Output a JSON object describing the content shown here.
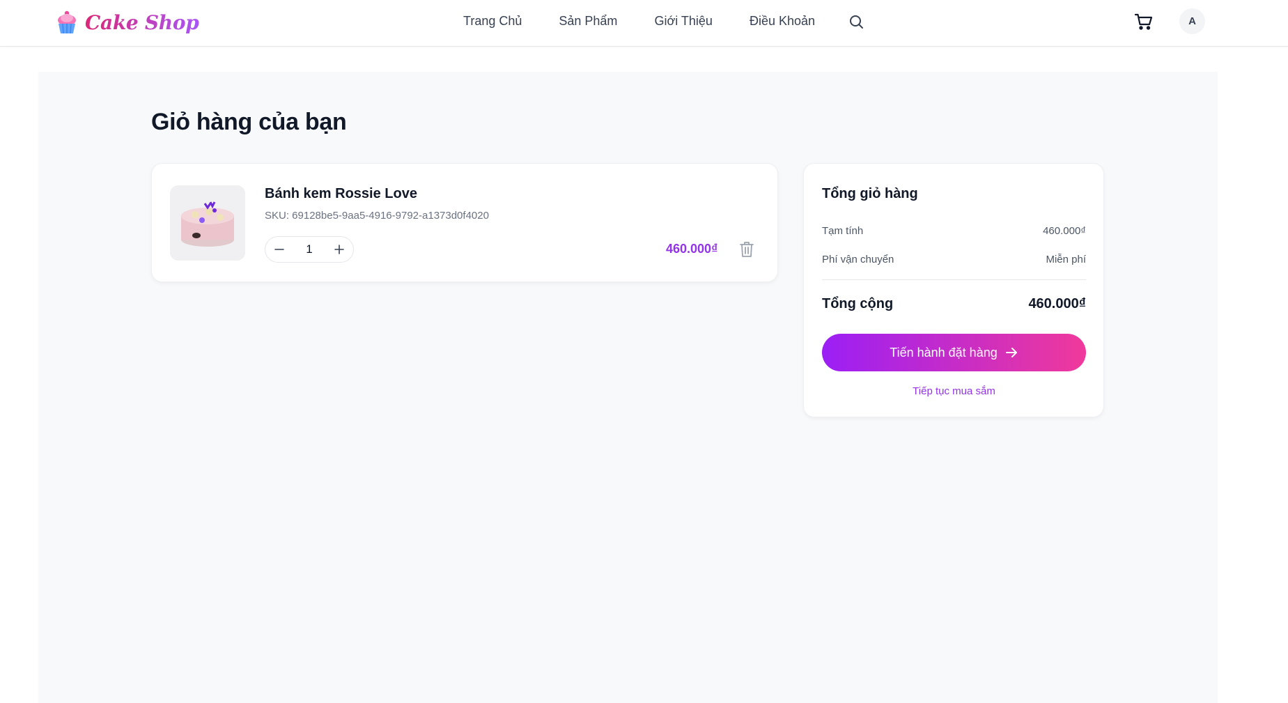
{
  "header": {
    "brand": "Cake Shop",
    "nav": [
      "Trang Chủ",
      "Sản Phẩm",
      "Giới Thiệu",
      "Điều Khoản"
    ],
    "avatar_initial": "A"
  },
  "cart": {
    "title": "Giỏ hàng của bạn",
    "items": [
      {
        "name": "Bánh kem Rossie Love",
        "sku": "SKU: 69128be5-9aa5-4916-9792-a1373d0f4020",
        "quantity": "1",
        "price": "460.000₫"
      }
    ]
  },
  "summary": {
    "title": "Tổng giỏ hàng",
    "subtotal_label": "Tạm tính",
    "subtotal_value": "460.000₫",
    "shipping_label": "Phí vận chuyển",
    "shipping_value": "Miễn phí",
    "total_label": "Tổng cộng",
    "total_value": "460.000₫",
    "checkout_label": "Tiến hành đặt hàng",
    "continue_label": "Tiếp tục mua sắm"
  },
  "colors": {
    "accent": "#9333ea",
    "gradient_start": "#9b1ff5",
    "gradient_end": "#f0399b",
    "page_bg": "#f8f9fb"
  }
}
